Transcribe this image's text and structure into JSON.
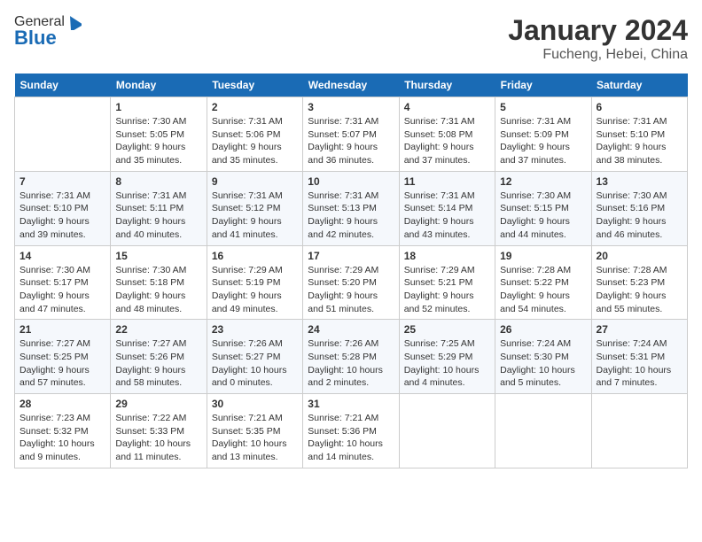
{
  "header": {
    "logo_general": "General",
    "logo_blue": "Blue",
    "month_year": "January 2024",
    "location": "Fucheng, Hebei, China"
  },
  "days_of_week": [
    "Sunday",
    "Monday",
    "Tuesday",
    "Wednesday",
    "Thursday",
    "Friday",
    "Saturday"
  ],
  "weeks": [
    [
      {
        "day": "",
        "info": ""
      },
      {
        "day": "1",
        "info": "Sunrise: 7:30 AM\nSunset: 5:05 PM\nDaylight: 9 hours\nand 35 minutes."
      },
      {
        "day": "2",
        "info": "Sunrise: 7:31 AM\nSunset: 5:06 PM\nDaylight: 9 hours\nand 35 minutes."
      },
      {
        "day": "3",
        "info": "Sunrise: 7:31 AM\nSunset: 5:07 PM\nDaylight: 9 hours\nand 36 minutes."
      },
      {
        "day": "4",
        "info": "Sunrise: 7:31 AM\nSunset: 5:08 PM\nDaylight: 9 hours\nand 37 minutes."
      },
      {
        "day": "5",
        "info": "Sunrise: 7:31 AM\nSunset: 5:09 PM\nDaylight: 9 hours\nand 37 minutes."
      },
      {
        "day": "6",
        "info": "Sunrise: 7:31 AM\nSunset: 5:10 PM\nDaylight: 9 hours\nand 38 minutes."
      }
    ],
    [
      {
        "day": "7",
        "info": "Sunrise: 7:31 AM\nSunset: 5:10 PM\nDaylight: 9 hours\nand 39 minutes."
      },
      {
        "day": "8",
        "info": "Sunrise: 7:31 AM\nSunset: 5:11 PM\nDaylight: 9 hours\nand 40 minutes."
      },
      {
        "day": "9",
        "info": "Sunrise: 7:31 AM\nSunset: 5:12 PM\nDaylight: 9 hours\nand 41 minutes."
      },
      {
        "day": "10",
        "info": "Sunrise: 7:31 AM\nSunset: 5:13 PM\nDaylight: 9 hours\nand 42 minutes."
      },
      {
        "day": "11",
        "info": "Sunrise: 7:31 AM\nSunset: 5:14 PM\nDaylight: 9 hours\nand 43 minutes."
      },
      {
        "day": "12",
        "info": "Sunrise: 7:30 AM\nSunset: 5:15 PM\nDaylight: 9 hours\nand 44 minutes."
      },
      {
        "day": "13",
        "info": "Sunrise: 7:30 AM\nSunset: 5:16 PM\nDaylight: 9 hours\nand 46 minutes."
      }
    ],
    [
      {
        "day": "14",
        "info": "Sunrise: 7:30 AM\nSunset: 5:17 PM\nDaylight: 9 hours\nand 47 minutes."
      },
      {
        "day": "15",
        "info": "Sunrise: 7:30 AM\nSunset: 5:18 PM\nDaylight: 9 hours\nand 48 minutes."
      },
      {
        "day": "16",
        "info": "Sunrise: 7:29 AM\nSunset: 5:19 PM\nDaylight: 9 hours\nand 49 minutes."
      },
      {
        "day": "17",
        "info": "Sunrise: 7:29 AM\nSunset: 5:20 PM\nDaylight: 9 hours\nand 51 minutes."
      },
      {
        "day": "18",
        "info": "Sunrise: 7:29 AM\nSunset: 5:21 PM\nDaylight: 9 hours\nand 52 minutes."
      },
      {
        "day": "19",
        "info": "Sunrise: 7:28 AM\nSunset: 5:22 PM\nDaylight: 9 hours\nand 54 minutes."
      },
      {
        "day": "20",
        "info": "Sunrise: 7:28 AM\nSunset: 5:23 PM\nDaylight: 9 hours\nand 55 minutes."
      }
    ],
    [
      {
        "day": "21",
        "info": "Sunrise: 7:27 AM\nSunset: 5:25 PM\nDaylight: 9 hours\nand 57 minutes."
      },
      {
        "day": "22",
        "info": "Sunrise: 7:27 AM\nSunset: 5:26 PM\nDaylight: 9 hours\nand 58 minutes."
      },
      {
        "day": "23",
        "info": "Sunrise: 7:26 AM\nSunset: 5:27 PM\nDaylight: 10 hours\nand 0 minutes."
      },
      {
        "day": "24",
        "info": "Sunrise: 7:26 AM\nSunset: 5:28 PM\nDaylight: 10 hours\nand 2 minutes."
      },
      {
        "day": "25",
        "info": "Sunrise: 7:25 AM\nSunset: 5:29 PM\nDaylight: 10 hours\nand 4 minutes."
      },
      {
        "day": "26",
        "info": "Sunrise: 7:24 AM\nSunset: 5:30 PM\nDaylight: 10 hours\nand 5 minutes."
      },
      {
        "day": "27",
        "info": "Sunrise: 7:24 AM\nSunset: 5:31 PM\nDaylight: 10 hours\nand 7 minutes."
      }
    ],
    [
      {
        "day": "28",
        "info": "Sunrise: 7:23 AM\nSunset: 5:32 PM\nDaylight: 10 hours\nand 9 minutes."
      },
      {
        "day": "29",
        "info": "Sunrise: 7:22 AM\nSunset: 5:33 PM\nDaylight: 10 hours\nand 11 minutes."
      },
      {
        "day": "30",
        "info": "Sunrise: 7:21 AM\nSunset: 5:35 PM\nDaylight: 10 hours\nand 13 minutes."
      },
      {
        "day": "31",
        "info": "Sunrise: 7:21 AM\nSunset: 5:36 PM\nDaylight: 10 hours\nand 14 minutes."
      },
      {
        "day": "",
        "info": ""
      },
      {
        "day": "",
        "info": ""
      },
      {
        "day": "",
        "info": ""
      }
    ]
  ]
}
